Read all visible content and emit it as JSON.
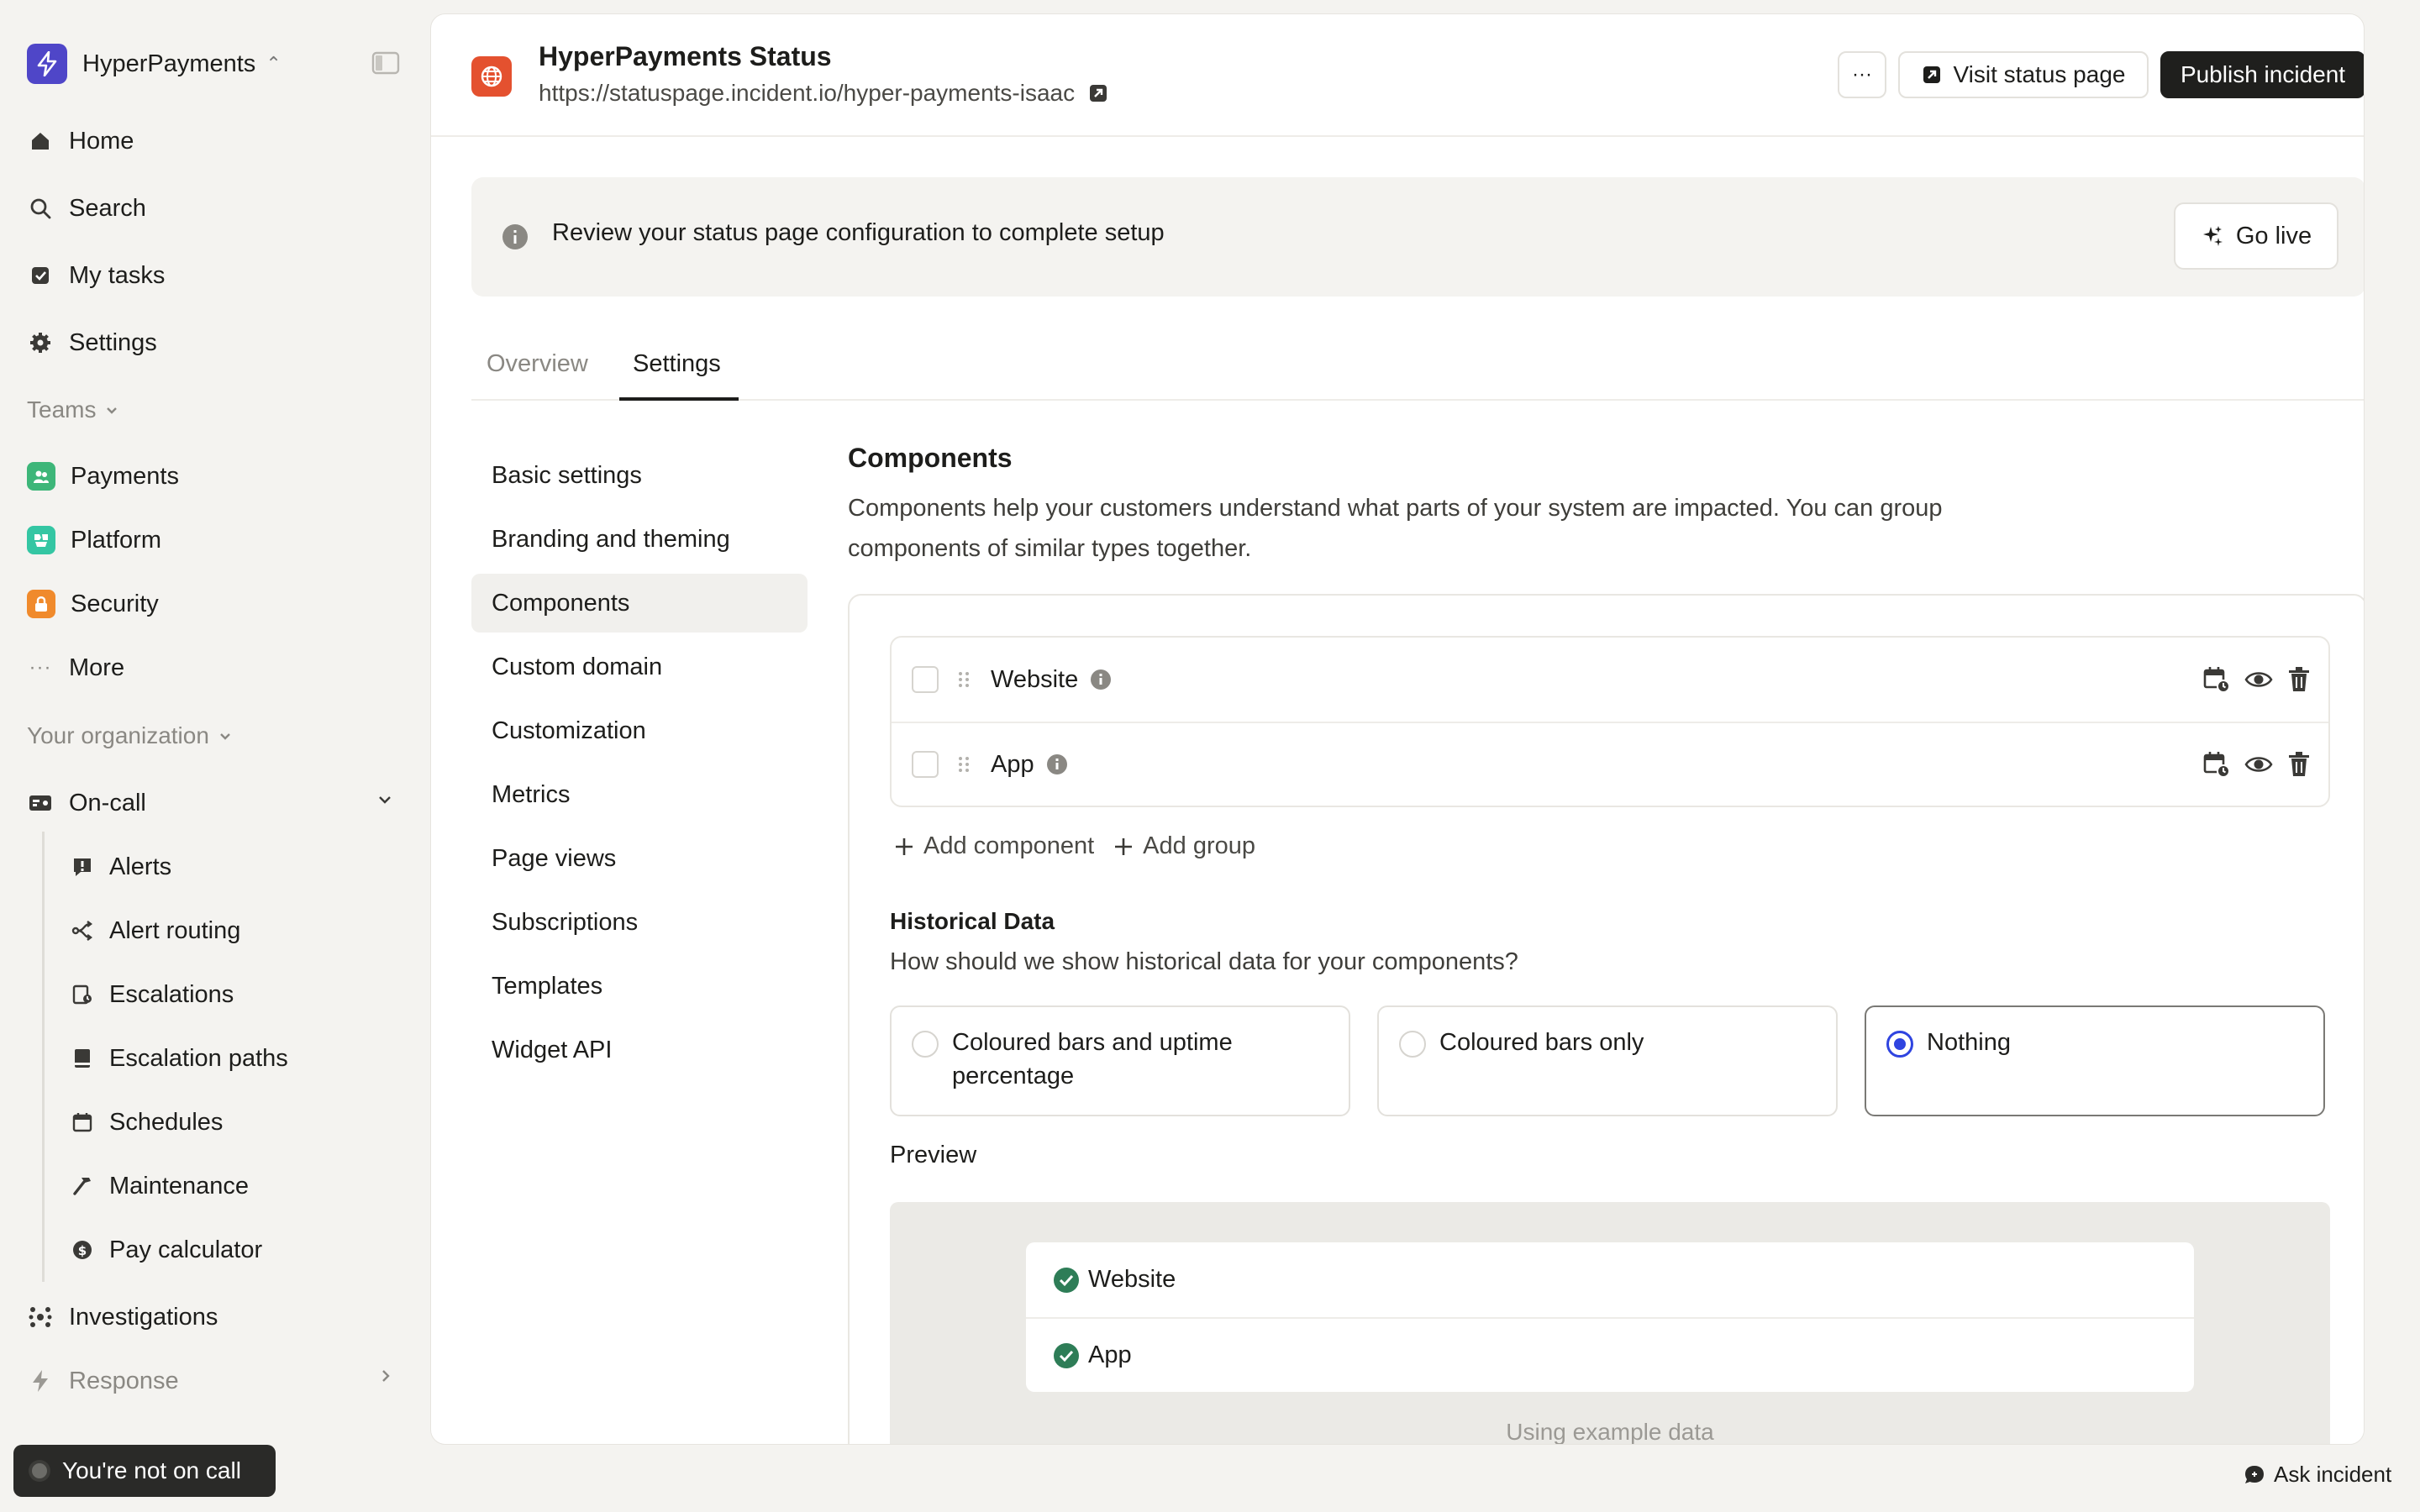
{
  "org": {
    "name": "HyperPayments"
  },
  "nav": {
    "home": "Home",
    "search": "Search",
    "tasks": "My tasks",
    "settings": "Settings",
    "teams_label": "Teams",
    "teams": [
      {
        "label": "Payments",
        "color": "#3db679"
      },
      {
        "label": "Platform",
        "color": "#34c6a3"
      },
      {
        "label": "Security",
        "color": "#f08a2c"
      }
    ],
    "more": "More",
    "org_label": "Your organization",
    "oncall": "On-call",
    "oncall_items": [
      "Alerts",
      "Alert routing",
      "Escalations",
      "Escalation paths",
      "Schedules",
      "Maintenance",
      "Pay calculator"
    ],
    "investigations": "Investigations",
    "response": "Response"
  },
  "oncall_status": "You're not on call",
  "header": {
    "title": "HyperPayments Status",
    "url": "https://statuspage.incident.io/hyper-payments-isaac",
    "more_label": "···",
    "visit_label": "Visit status page",
    "publish_label": "Publish incident"
  },
  "banner": {
    "text": "Review your status page configuration to complete setup",
    "go_live_label": "Go live"
  },
  "tabs": [
    "Overview",
    "Settings"
  ],
  "subnav": [
    "Basic settings",
    "Branding and theming",
    "Components",
    "Custom domain",
    "Customization",
    "Metrics",
    "Page views",
    "Subscriptions",
    "Templates",
    "Widget API"
  ],
  "components": {
    "title": "Components",
    "description": "Components help your customers understand what parts of your system are impacted. You can group components of similar types together.",
    "items": [
      "Website",
      "App"
    ],
    "add_component": "Add component",
    "add_group": "Add group"
  },
  "historical": {
    "title": "Historical Data",
    "question": "How should we show historical data for your components?",
    "options": [
      "Coloured bars and uptime percentage",
      "Coloured bars only",
      "Nothing"
    ],
    "selected": "Nothing"
  },
  "preview": {
    "title": "Preview",
    "items": [
      "Website",
      "App"
    ],
    "note": "Using example data"
  },
  "ask_label": "Ask incident",
  "colors": {
    "accent": "#2f44e0",
    "brand": "#4f46c8",
    "status_icon": "#e4512f",
    "ok": "#2e7d57"
  }
}
